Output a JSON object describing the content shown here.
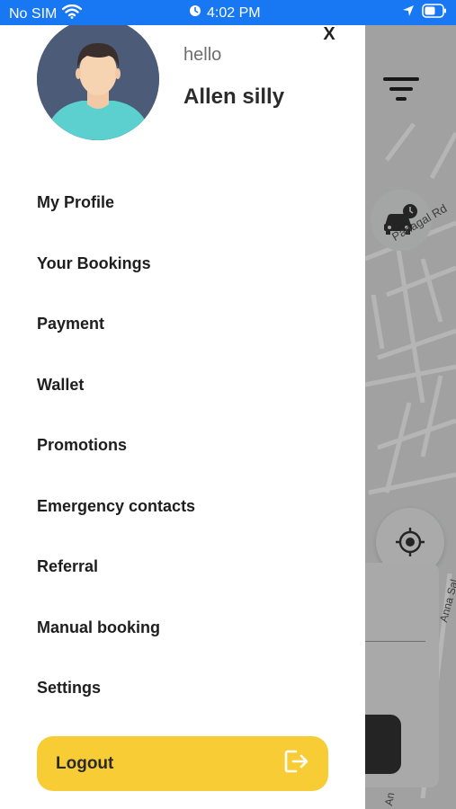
{
  "status_bar": {
    "carrier": "No SIM",
    "time": "4:02 PM",
    "icons": [
      "wifi-icon",
      "alarm-icon",
      "location-arrow-icon",
      "battery-icon"
    ]
  },
  "drawer": {
    "greeting": "hello",
    "user_name": "Allen silly",
    "close_label": "X",
    "menu_items": [
      {
        "label": "My Profile"
      },
      {
        "label": "Your Bookings"
      },
      {
        "label": "Payment"
      },
      {
        "label": "Wallet"
      },
      {
        "label": "Promotions"
      },
      {
        "label": "Emergency contacts"
      },
      {
        "label": "Referral"
      },
      {
        "label": "Manual booking"
      },
      {
        "label": "Settings"
      }
    ],
    "logout_label": "Logout",
    "logout_icon": "logout-icon"
  },
  "map": {
    "road_labels": [
      "Panagal Rd",
      "Anna Sal",
      "An"
    ],
    "icons": [
      "filter-icon",
      "car-clock-icon",
      "locate-icon"
    ]
  },
  "colors": {
    "status_bar": "#1877f2",
    "logout_button": "#f8cc35",
    "avatar_bg": "#4c5b78",
    "avatar_shirt": "#5ccfcf"
  }
}
